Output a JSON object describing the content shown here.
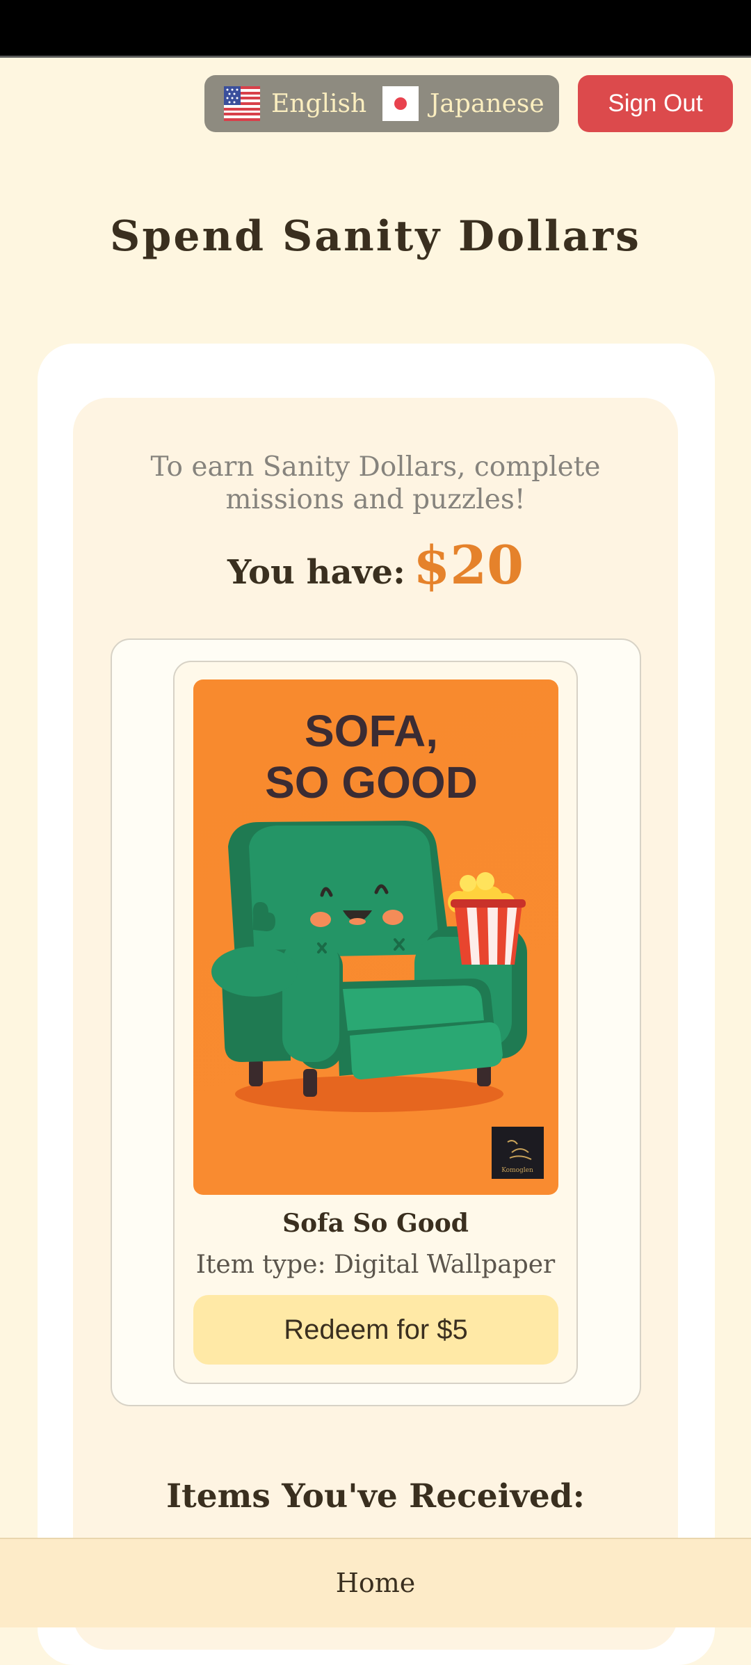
{
  "header": {
    "languages": [
      {
        "label": "English",
        "flag_icon": "us-flag-icon"
      },
      {
        "label": "Japanese",
        "flag_icon": "japan-flag-icon"
      }
    ],
    "sign_out_label": "Sign Out"
  },
  "page_title": "Spend Sanity Dollars",
  "earn_note": "To earn Sanity Dollars, complete missions and puzzles!",
  "balance": {
    "label": "You have:",
    "value": "$20"
  },
  "shop_items": [
    {
      "wallpaper": {
        "headline_line1": "SOFA,",
        "headline_line2": "SO GOOD",
        "badge_text": "Komoglen"
      },
      "name": "Sofa So Good",
      "type_text": "Item type: Digital Wallpaper",
      "redeem_label": "Redeem for $5"
    }
  ],
  "received_heading": "Items You've Received:",
  "bottom_nav": {
    "home_label": "Home"
  },
  "colors": {
    "background": "#fef6e0",
    "accent_orange": "#e5822b",
    "sign_out_red": "#dc4a4c",
    "redeem_yellow": "#ffe9a6",
    "wallpaper_orange": "#f88a2e",
    "sofa_green": "#249566"
  }
}
